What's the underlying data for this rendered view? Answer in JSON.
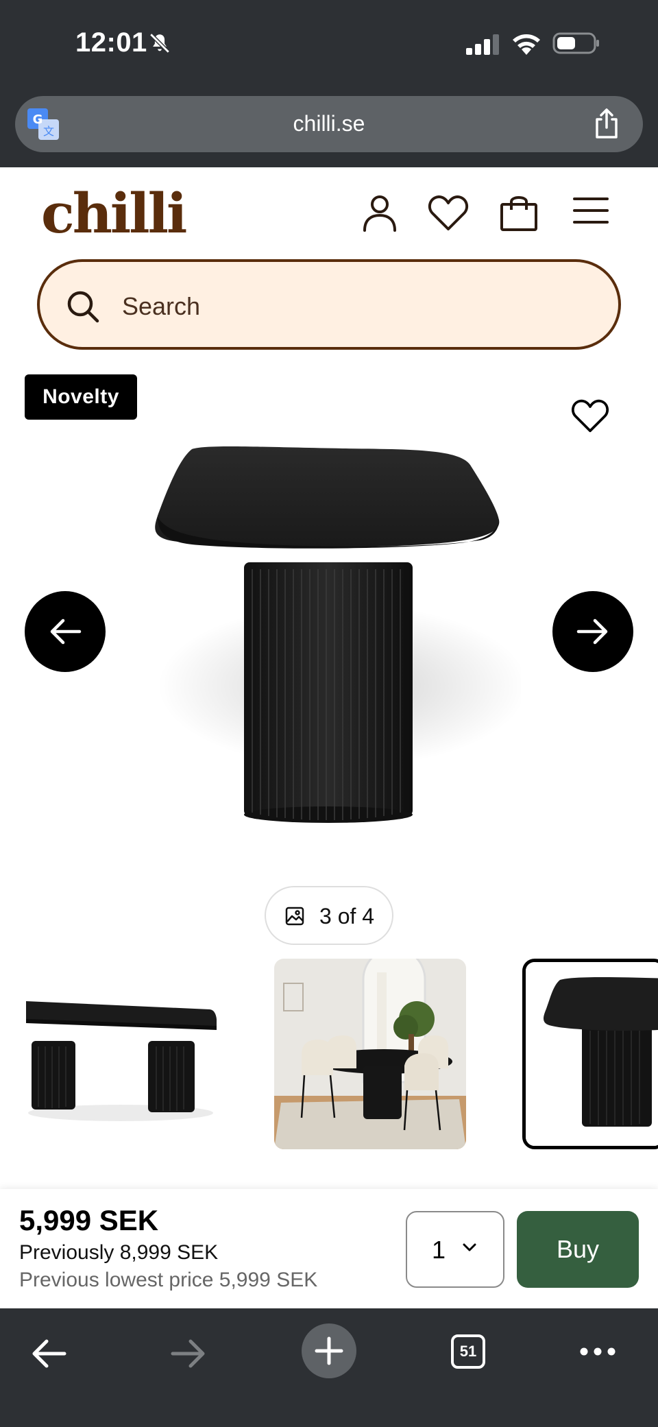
{
  "status_bar": {
    "time": "12:01"
  },
  "browser": {
    "url": "chilli.se",
    "tab_count": "51"
  },
  "header": {
    "logo": "chilli",
    "brand_color": "#5a2d0c",
    "icons": [
      "account-icon",
      "heart-icon",
      "bag-icon",
      "menu-icon"
    ]
  },
  "search": {
    "placeholder": "Search",
    "background_color": "#fff0e2"
  },
  "gallery": {
    "badge": "Novelty",
    "counter": "3 of 4",
    "current_image": 3,
    "total_images": 4
  },
  "purchase": {
    "price": "5,999 SEK",
    "previous_price": "Previously 8,999 SEK",
    "lowest_price": "Previous lowest price 5,999 SEK",
    "quantity": "1",
    "buy_label": "Buy",
    "buy_color": "#355f3f"
  }
}
